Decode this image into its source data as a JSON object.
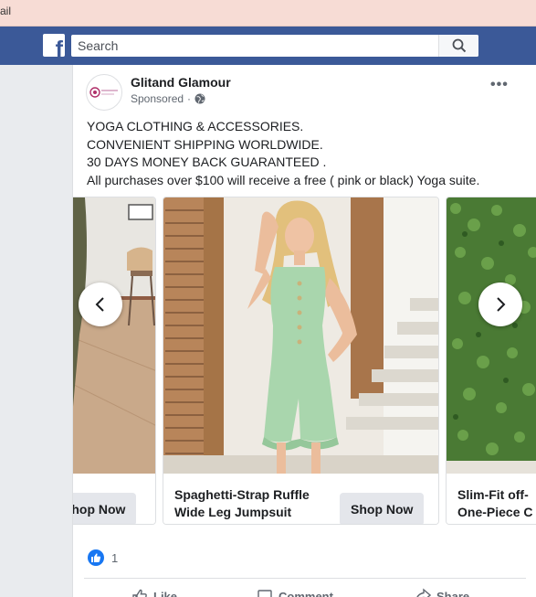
{
  "browser": {
    "tab_text": "ail"
  },
  "header": {
    "search_placeholder": "Search"
  },
  "post": {
    "page_name": "Glitand Glamour",
    "sponsored_label": "Sponsored",
    "more_label": "•••",
    "text_lines": [
      "YOGA CLOTHING & ACCESSORIES.",
      "CONVENIENT SHIPPING WORLDWIDE.",
      "30 DAYS MONEY BACK GUARANTEED .",
      "All purchases over $100 will receive a free ( pink or black) Yoga suite."
    ],
    "carousel": {
      "cards": [
        {
          "title_lines": [
            "",
            ""
          ],
          "button": "Shop Now"
        },
        {
          "title_lines": [
            "Spaghetti-Strap Ruffle",
            "Wide Leg Jumpsuit"
          ],
          "button": "Shop Now"
        },
        {
          "title_lines": [
            "Slim-Fit off-",
            "One-Piece C"
          ],
          "button": ""
        }
      ]
    },
    "reaction_count": "1",
    "actions": [
      "Like",
      "Comment",
      "Share"
    ]
  },
  "colors": {
    "facebook_blue": "#3b5998",
    "like_blue": "#1877f2",
    "tab_strip": "#f7dcd5"
  }
}
